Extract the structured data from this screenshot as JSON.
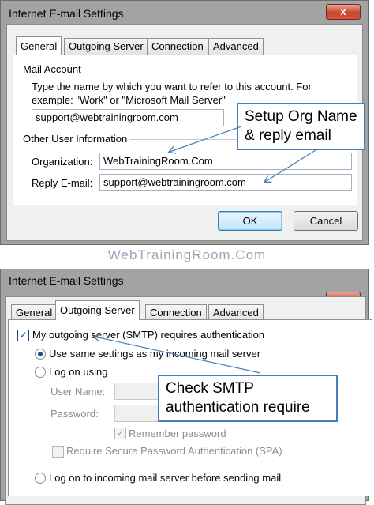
{
  "top_dialog": {
    "title": "Internet E-mail Settings",
    "close_label": "x",
    "tabs": [
      "General",
      "Outgoing Server",
      "Connection",
      "Advanced"
    ],
    "mail_account_label": "Mail Account",
    "instruction_line1": "Type the name by which you want to refer to this account. For",
    "instruction_line2": "example: \"Work\" or \"Microsoft Mail Server\"",
    "account_name": "support@webtrainingroom.com",
    "other_info_label": "Other User Information",
    "organization_label": "Organization:",
    "organization_value": "WebTrainingRoom.Com",
    "reply_label": "Reply E-mail:",
    "reply_value": "support@webtrainingroom.com",
    "ok_label": "OK",
    "cancel_label": "Cancel",
    "callout_line1": "Setup Org Name",
    "callout_line2": "& reply email"
  },
  "watermark": "WebTrainingRoom.Com",
  "bottom_dialog": {
    "title": "Internet E-mail Settings",
    "close_label": "x",
    "tabs": [
      "General",
      "Outgoing Server",
      "Connection",
      "Advanced"
    ],
    "smtp_auth_label": "My outgoing server (SMTP) requires authentication",
    "use_same_label": "Use same settings as my incoming mail server",
    "log_on_using_label": "Log on using",
    "username_label": "User Name:",
    "password_label": "Password:",
    "remember_label": "Remember password",
    "spa_label": "Require Secure Password Authentication (SPA)",
    "log_on_incoming_label": "Log on to incoming mail server before sending mail",
    "callout_line1": "Check SMTP",
    "callout_line2": "authentication require"
  },
  "colors": {
    "accent": "#4a7ebb",
    "close_button": "#c7462f",
    "frame": "#a3a3a3"
  }
}
